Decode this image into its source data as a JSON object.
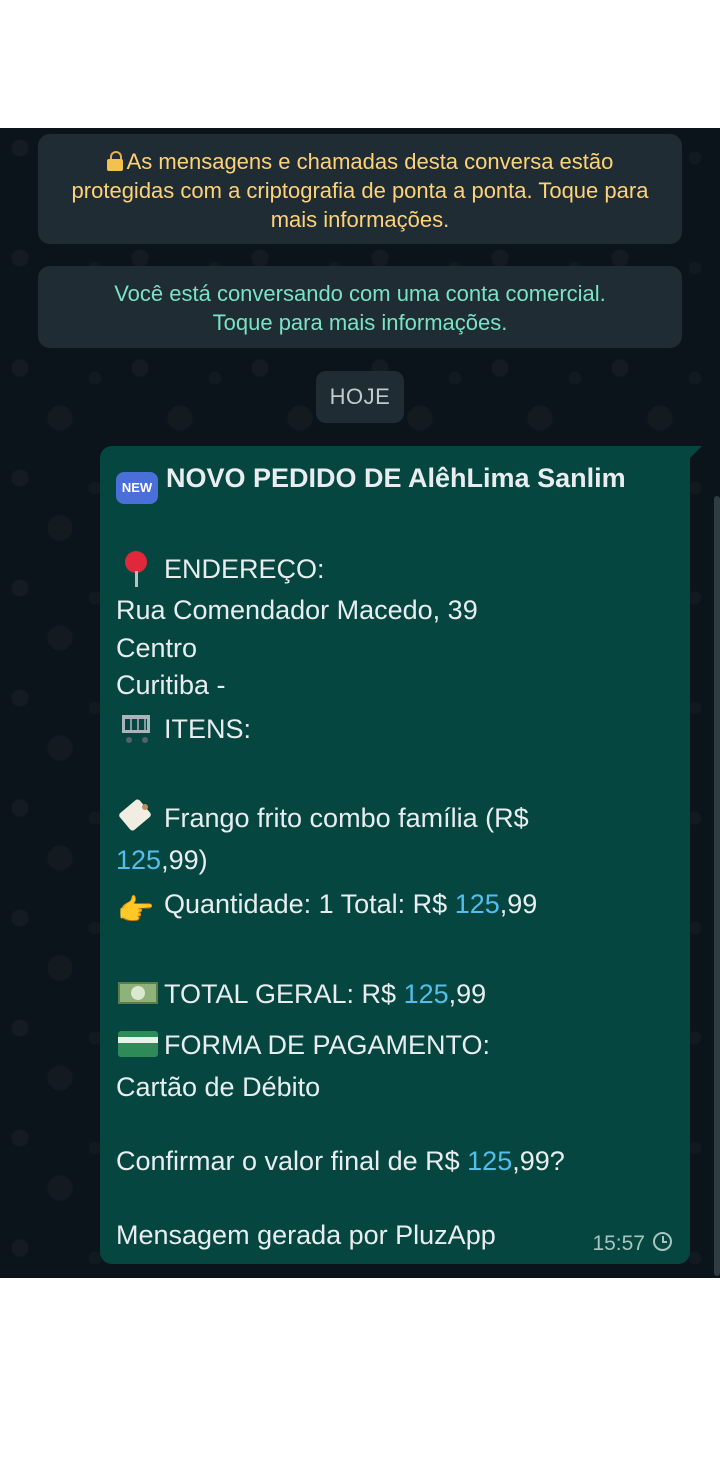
{
  "system": {
    "encryption_notice": "As mensagens e chamadas desta conversa estão protegidas com a criptografia de ponta a ponta. Toque para mais informações.",
    "business_notice_line1": "Você está conversando com uma conta comercial.",
    "business_notice_line2": "Toque para mais informações."
  },
  "date_chip": "HOJE",
  "message": {
    "title": "NOVO PEDIDO DE AlêhLima Sanlim",
    "address_label": "ENDEREÇO:",
    "street": "Rua Comendador Macedo, 39",
    "district": "Centro",
    "city": "Curitiba -",
    "items_label": "ITENS:",
    "item_line1": "Frango frito combo família (R$",
    "item_price_int": "125",
    "item_price_tail": ",99)",
    "qty_text": "Quantidade: 1 Total: R$ ",
    "qty_total_int": "125",
    "qty_total_dec": ",99",
    "grand_total_text": "TOTAL GERAL: R$ ",
    "grand_total_int": "125",
    "grand_total_dec": ",99",
    "payment_label": "FORMA DE PAGAMENTO:",
    "payment_method": "Cartão de Débito",
    "confirm_text": "Confirmar o valor final de R$ ",
    "confirm_int": "125",
    "confirm_tail": ",99?",
    "footer": "Mensagem gerada por PluzApp",
    "time": "15:57"
  },
  "icons": {
    "new_badge": "NEW",
    "pointing_hand": "👉"
  }
}
